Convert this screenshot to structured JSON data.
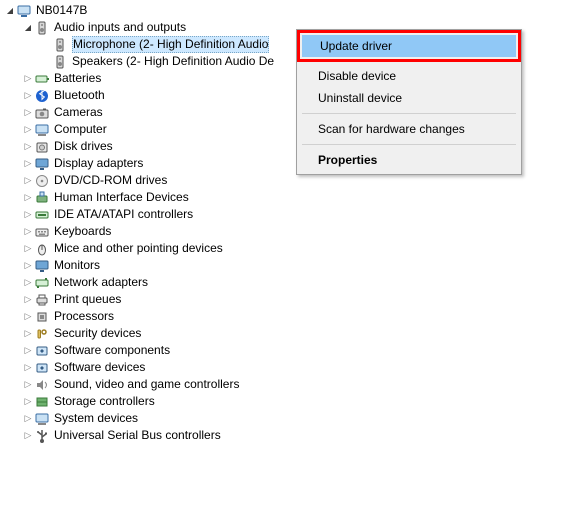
{
  "root": {
    "label": "NB0147B"
  },
  "audio": {
    "label": "Audio inputs and outputs",
    "children": [
      {
        "label": "Microphone (2- High Definition Audio"
      },
      {
        "label": "Speakers (2- High Definition Audio De"
      }
    ]
  },
  "categories": [
    {
      "label": "Batteries",
      "icon": "battery"
    },
    {
      "label": "Bluetooth",
      "icon": "bluetooth"
    },
    {
      "label": "Cameras",
      "icon": "camera"
    },
    {
      "label": "Computer",
      "icon": "computer"
    },
    {
      "label": "Disk drives",
      "icon": "disk"
    },
    {
      "label": "Display adapters",
      "icon": "display"
    },
    {
      "label": "DVD/CD-ROM drives",
      "icon": "dvd"
    },
    {
      "label": "Human Interface Devices",
      "icon": "hid"
    },
    {
      "label": "IDE ATA/ATAPI controllers",
      "icon": "ide"
    },
    {
      "label": "Keyboards",
      "icon": "keyboard"
    },
    {
      "label": "Mice and other pointing devices",
      "icon": "mouse"
    },
    {
      "label": "Monitors",
      "icon": "monitor"
    },
    {
      "label": "Network adapters",
      "icon": "network"
    },
    {
      "label": "Print queues",
      "icon": "printer"
    },
    {
      "label": "Processors",
      "icon": "cpu"
    },
    {
      "label": "Security devices",
      "icon": "security"
    },
    {
      "label": "Software components",
      "icon": "software"
    },
    {
      "label": "Software devices",
      "icon": "software"
    },
    {
      "label": "Sound, video and game controllers",
      "icon": "sound"
    },
    {
      "label": "Storage controllers",
      "icon": "storage"
    },
    {
      "label": "System devices",
      "icon": "system"
    },
    {
      "label": "Universal Serial Bus controllers",
      "icon": "usb"
    }
  ],
  "context_menu": {
    "update": "Update driver",
    "disable": "Disable device",
    "uninstall": "Uninstall device",
    "scan": "Scan for hardware changes",
    "props": "Properties"
  }
}
